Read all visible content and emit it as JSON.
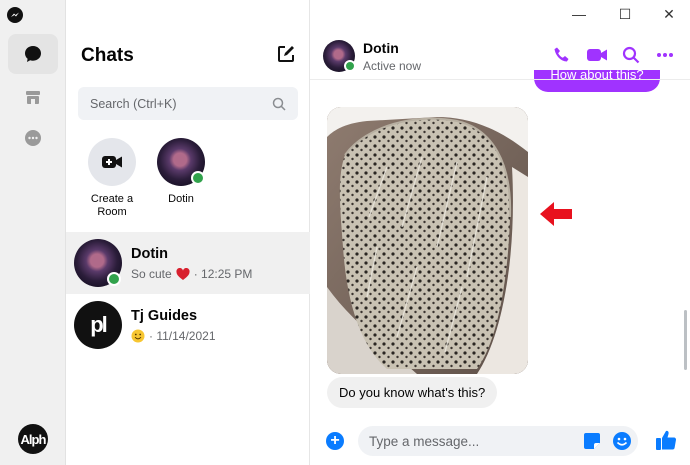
{
  "rail": {
    "avatar_text": "Alph"
  },
  "sidebar": {
    "title": "Chats",
    "search": {
      "placeholder": "Search (Ctrl+K)"
    },
    "stories": [
      {
        "label": "Create a Room"
      },
      {
        "label": "Dotin"
      }
    ],
    "threads": [
      {
        "name": "Dotin",
        "preview": "So cute",
        "time": "· 12:25 PM",
        "active": true
      },
      {
        "name": "Tj Guides",
        "preview": "",
        "time": "· 11/14/2021",
        "avatar_text": "pl"
      }
    ]
  },
  "conversation": {
    "contact_name": "Dotin",
    "contact_status": "Active now",
    "previous_message": "How about this?",
    "received_message": "Do you know what's this?",
    "composer": {
      "placeholder": "Type a message..."
    }
  },
  "window_controls": {
    "minimize": "—",
    "maximize": "☐",
    "close": "✕"
  },
  "colors": {
    "accent": "#a033ff",
    "blue": "#0a7cff",
    "online": "#31a24c",
    "arrow": "#e8111e"
  }
}
